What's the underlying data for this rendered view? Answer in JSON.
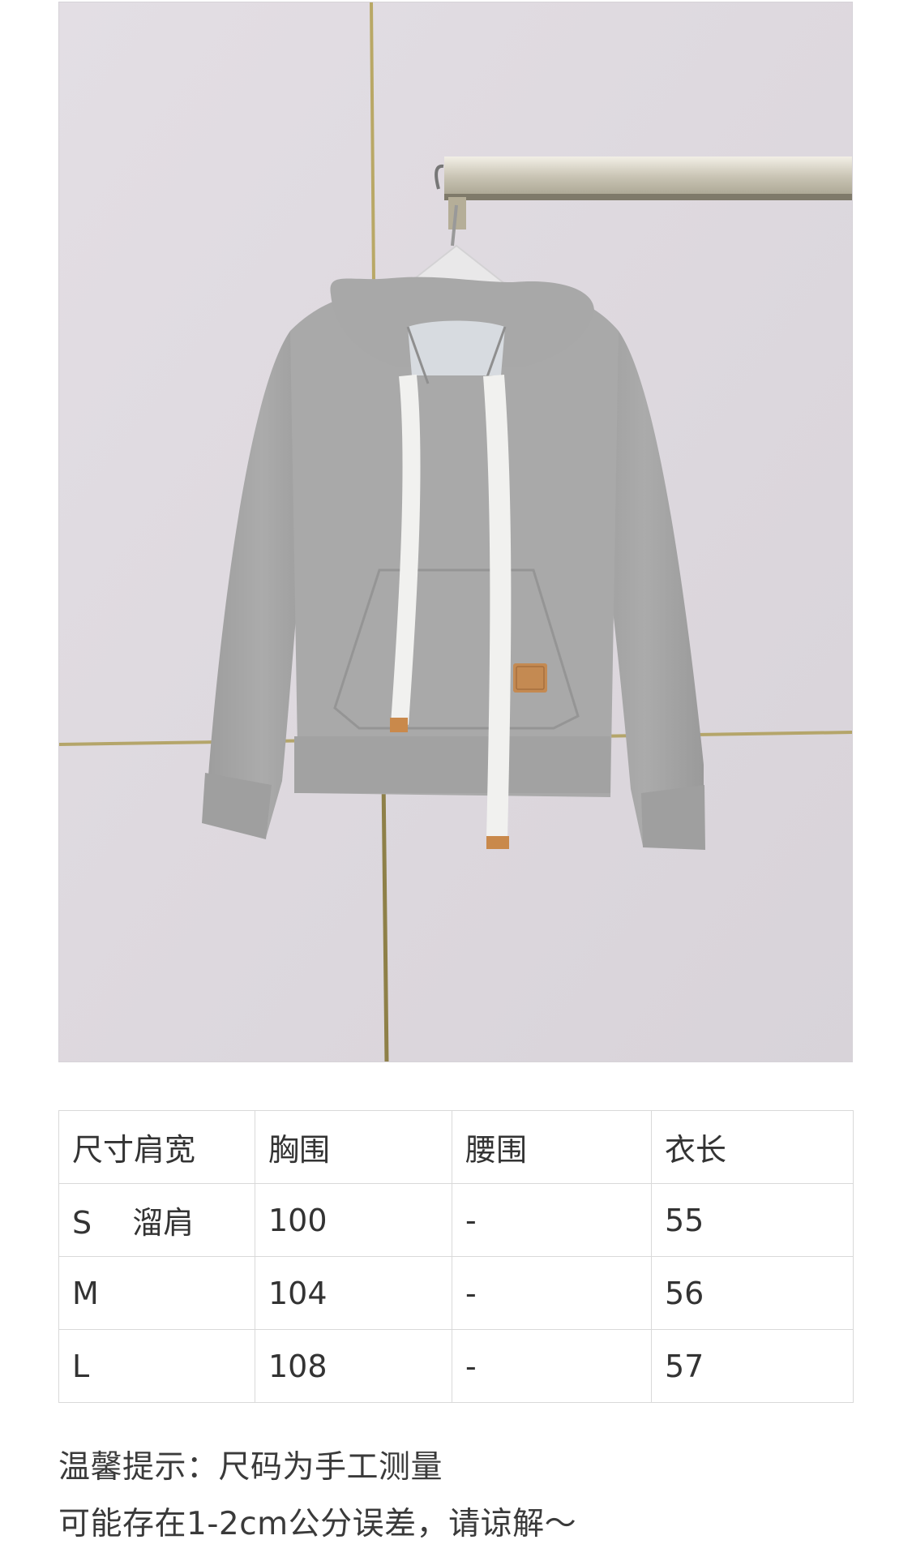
{
  "product_image": {
    "description_icon": "hoodie-photo"
  },
  "size_table": {
    "header": [
      "尺寸肩宽",
      "胸围",
      "腰围",
      "衣长"
    ],
    "rows": [
      [
        "S　 溜肩",
        "100",
        "-",
        "55"
      ],
      [
        "M",
        "104",
        "-",
        "56"
      ],
      [
        "L",
        "108",
        "-",
        "57"
      ]
    ]
  },
  "notes": {
    "line1": "温馨提示：尺码为手工测量",
    "line2": "可能存在1-2cm公分误差，请谅解～"
  },
  "colors": {
    "hoodie": "#a7a7a7",
    "wall": "#ddd8df",
    "table_border": "#d9d9d9"
  }
}
